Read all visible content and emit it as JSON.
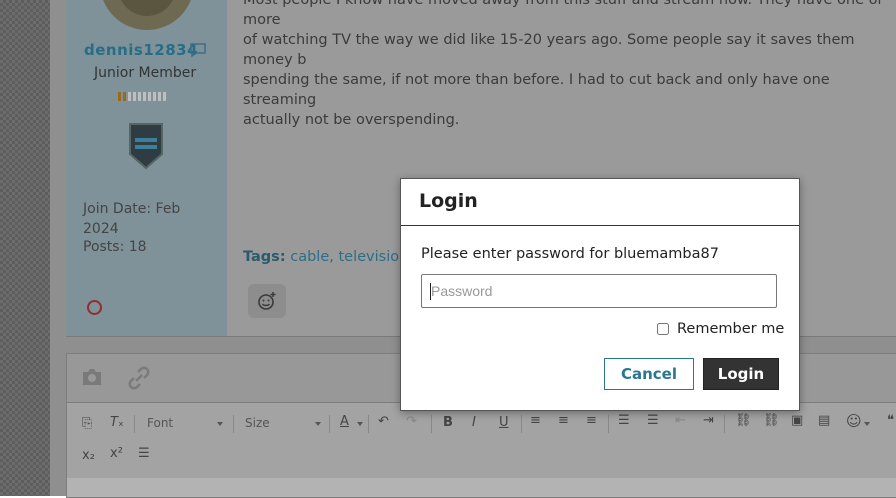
{
  "user": {
    "username": "dennis12834",
    "rank": "Junior Member",
    "join_date": "Join Date: Feb 2024",
    "posts": "Posts: 18",
    "reputation_filled": 2,
    "reputation_total": 10
  },
  "post": {
    "text": "Most people I know have moved away from this stuff and stream now. They have one or more\nof watching TV the way we did like 15-20 years ago. Some people say it saves them money b\nspending the same, if not more than before. I had to cut back and only have one streaming\nactually not be overspending.",
    "tags_label": "Tags:",
    "tags": [
      "cable",
      "television"
    ],
    "tag_separator": ","
  },
  "editor": {
    "font_label": "Font",
    "size_label": "Size",
    "text_color_label": "A"
  },
  "modal": {
    "title": "Login",
    "prompt": "Please enter password for bluemamba87",
    "password_placeholder": "Password",
    "remember_label": "Remember me",
    "cancel_label": "Cancel",
    "login_label": "Login"
  },
  "colors": {
    "accent": "#2a7890",
    "login_button": "#333333",
    "overlay_gray": "#8f8f8f"
  }
}
